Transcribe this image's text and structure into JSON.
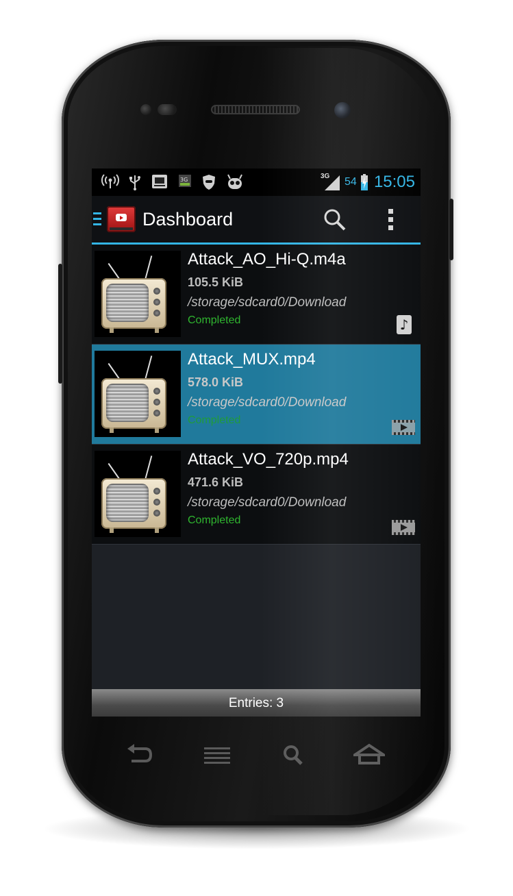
{
  "statusbar": {
    "icons": [
      "wifi-hotspot-icon",
      "usb-icon",
      "download-app-icon",
      "3g-data-icon",
      "shield-icon",
      "android-icon"
    ],
    "network": "3G",
    "battery": "54",
    "time": "15:05"
  },
  "actionbar": {
    "title": "Dashboard"
  },
  "downloads": [
    {
      "name": "Attack_AO_Hi-Q.m4a",
      "size": "105.5 KiB",
      "path": "/storage/sdcard0/Download",
      "status": "Completed",
      "type": "audio"
    },
    {
      "name": "Attack_MUX.mp4",
      "size": "578.0 KiB",
      "path": "/storage/sdcard0/Download",
      "status": "Completed",
      "type": "video",
      "selected": true
    },
    {
      "name": "Attack_VO_720p.mp4",
      "size": "471.6 KiB",
      "path": "/storage/sdcard0/Download",
      "status": "Completed",
      "type": "video"
    }
  ],
  "footer": {
    "entries": "Entries: 3"
  },
  "colors": {
    "accent": "#33b5e5",
    "selected_row": "#207a9c",
    "completed": "#2fb52f"
  }
}
